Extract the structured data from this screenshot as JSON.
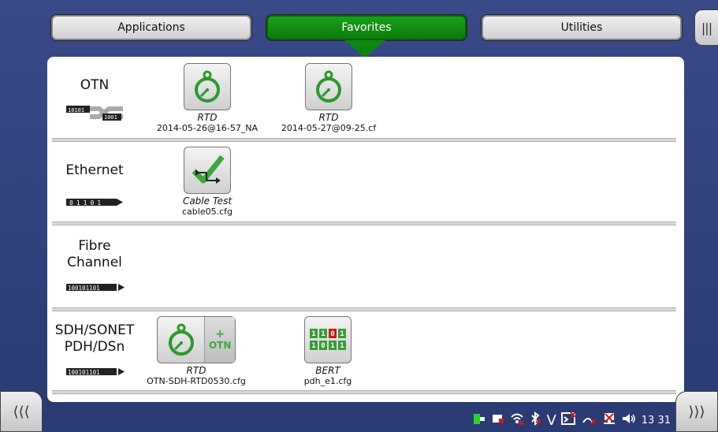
{
  "tabs": [
    {
      "label": "Applications",
      "active": false
    },
    {
      "label": "Favorites",
      "active": true
    },
    {
      "label": "Utilities",
      "active": false
    }
  ],
  "nav": {
    "left_icon": "chevron-left-triple-icon",
    "right_icon": "chevron-right-triple-icon",
    "menu_icon": "menu-handle-icon"
  },
  "categories": [
    {
      "label": "OTN",
      "icon": "otn-bits-icon",
      "icon_text": [
        "10101",
        "01",
        "1001"
      ],
      "favorites": [
        {
          "name": "RTD",
          "file": "2014-05-26@16-57_NA",
          "icon": "stopwatch-icon"
        },
        {
          "name": "RTD",
          "file": "2014-05-27@09-25.cf",
          "icon": "stopwatch-icon"
        }
      ]
    },
    {
      "label": "Ethernet",
      "icon": "ethernet-bits-icon",
      "icon_text": "01101",
      "favorites": [
        {
          "name": "Cable Test",
          "file": "cable05.cfg",
          "icon": "cable-test-icon"
        }
      ]
    },
    {
      "label_line1": "Fibre",
      "label_line2": "Channel",
      "icon": "fibre-channel-bits-icon",
      "icon_text": "100101101",
      "favorites": []
    },
    {
      "label_line1": "SDH/SONET",
      "label_line2": "PDH/DSn",
      "icon": "sdh-bits-icon",
      "icon_text": "100101101",
      "favorites": [
        {
          "name": "RTD",
          "file": "OTN-SDH-RTD0530.cfg",
          "icon": "stopwatch-otn-icon",
          "badge": "OTN",
          "plus": "+"
        },
        {
          "name": "BERT",
          "file": "pdh_e1.cfg",
          "icon": "bert-icon",
          "grid_rows": [
            "1101",
            "1011"
          ]
        }
      ]
    }
  ],
  "status": {
    "time": "13 31"
  },
  "colors": {
    "accent_green": "#0d860d",
    "bit_green": "#3a9a3a",
    "bit_red": "#d01818",
    "background": "#2f3f7a"
  }
}
